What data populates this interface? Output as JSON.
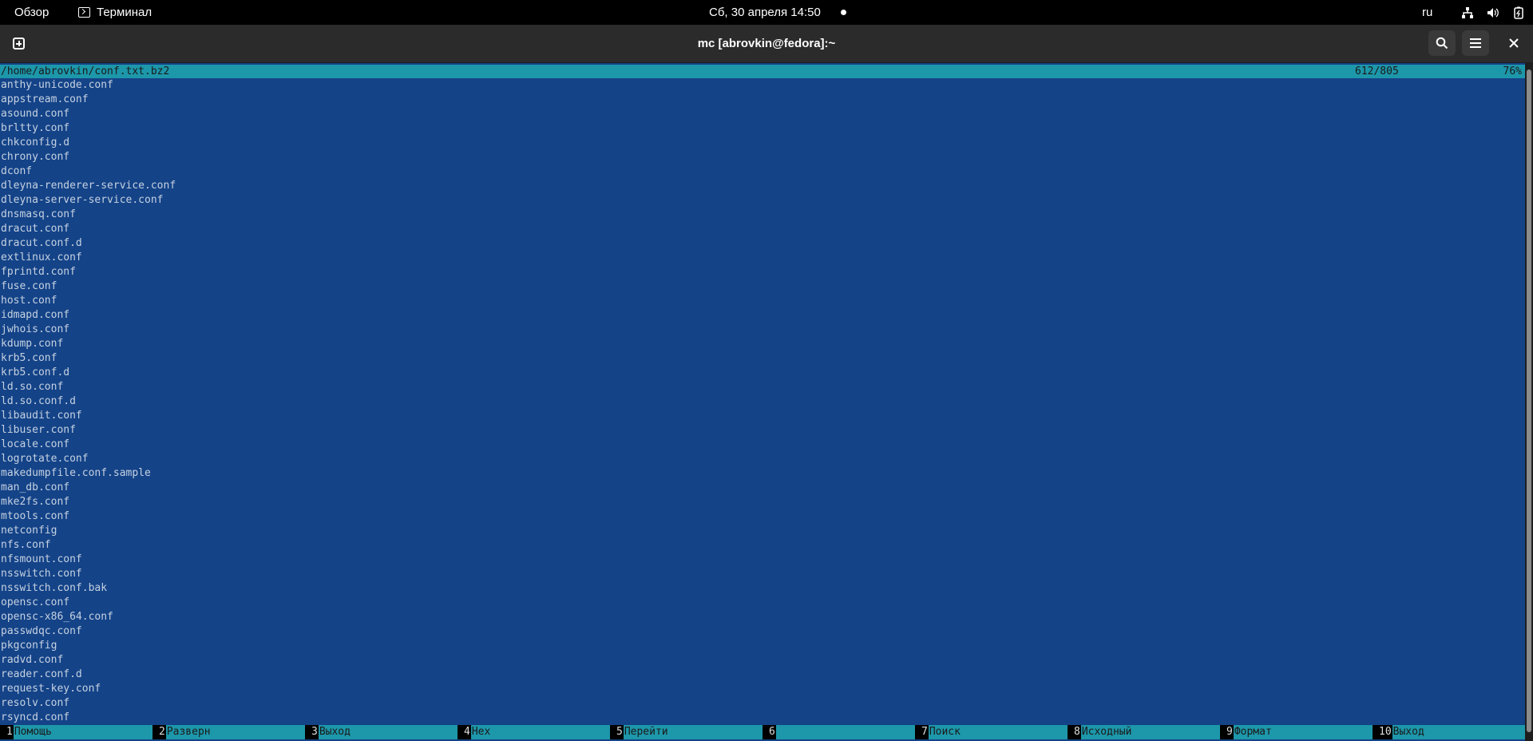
{
  "topbar": {
    "overview": "Обзор",
    "app_name": "Терминал",
    "clock": "Сб, 30 апреля  14:50",
    "lang": "ru",
    "tray_icons": [
      "network-icon",
      "volume-icon",
      "battery-icon"
    ]
  },
  "window": {
    "title": "mc [abrovkin@fedora]:~"
  },
  "viewer": {
    "path": "/home/abrovkin/conf.txt.bz2",
    "position": "612/805",
    "percent": "76%",
    "lines": [
      "anthy-unicode.conf",
      "appstream.conf",
      "asound.conf",
      "brltty.conf",
      "chkconfig.d",
      "chrony.conf",
      "dconf",
      "dleyna-renderer-service.conf",
      "dleyna-server-service.conf",
      "dnsmasq.conf",
      "dracut.conf",
      "dracut.conf.d",
      "extlinux.conf",
      "fprintd.conf",
      "fuse.conf",
      "host.conf",
      "idmapd.conf",
      "jwhois.conf",
      "kdump.conf",
      "krb5.conf",
      "krb5.conf.d",
      "ld.so.conf",
      "ld.so.conf.d",
      "libaudit.conf",
      "libuser.conf",
      "locale.conf",
      "logrotate.conf",
      "makedumpfile.conf.sample",
      "man_db.conf",
      "mke2fs.conf",
      "mtools.conf",
      "netconfig",
      "nfs.conf",
      "nfsmount.conf",
      "nsswitch.conf",
      "nsswitch.conf.bak",
      "opensc.conf",
      "opensc-x86_64.conf",
      "passwdqc.conf",
      "pkgconfig",
      "radvd.conf",
      "reader.conf.d",
      "request-key.conf",
      "resolv.conf",
      "rsyncd.conf"
    ]
  },
  "fkeys": [
    {
      "num": "1",
      "label": "Помощь"
    },
    {
      "num": "2",
      "label": "Разверн"
    },
    {
      "num": "3",
      "label": "Выход"
    },
    {
      "num": "4",
      "label": "Hex"
    },
    {
      "num": "5",
      "label": "Перейти"
    },
    {
      "num": "6",
      "label": ""
    },
    {
      "num": "7",
      "label": "Поиск"
    },
    {
      "num": "8",
      "label": "Исходный"
    },
    {
      "num": "9",
      "label": "Формат"
    },
    {
      "num": "10",
      "label": "Выход"
    }
  ]
}
